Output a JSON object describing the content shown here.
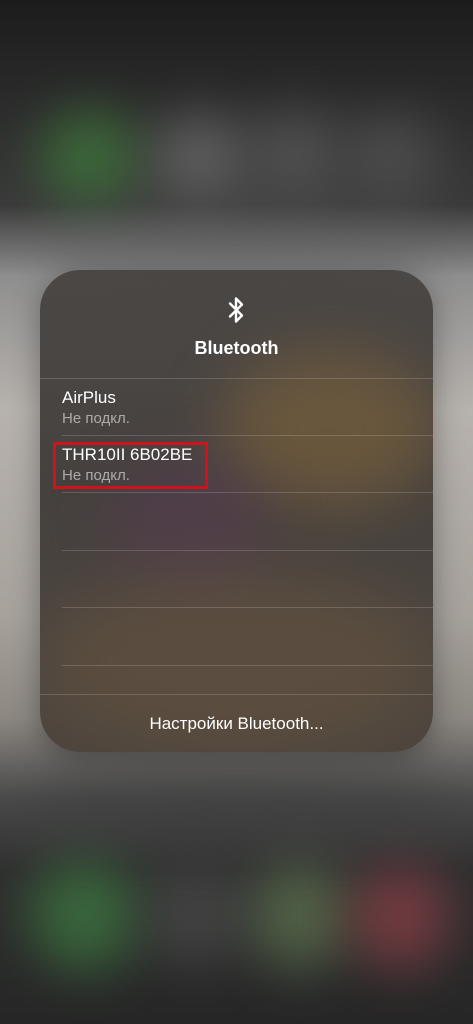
{
  "panel": {
    "title": "Bluetooth",
    "icon": "bluetooth-icon"
  },
  "devices": [
    {
      "name": "AirPlus",
      "status": "Не подкл."
    },
    {
      "name": "THR10II 6B02BE",
      "status": "Не подкл.",
      "highlighted": true
    }
  ],
  "settings_button": {
    "label": "Настройки Bluetooth..."
  },
  "colors": {
    "highlight": "#d0121b",
    "text": "#ffffff"
  }
}
